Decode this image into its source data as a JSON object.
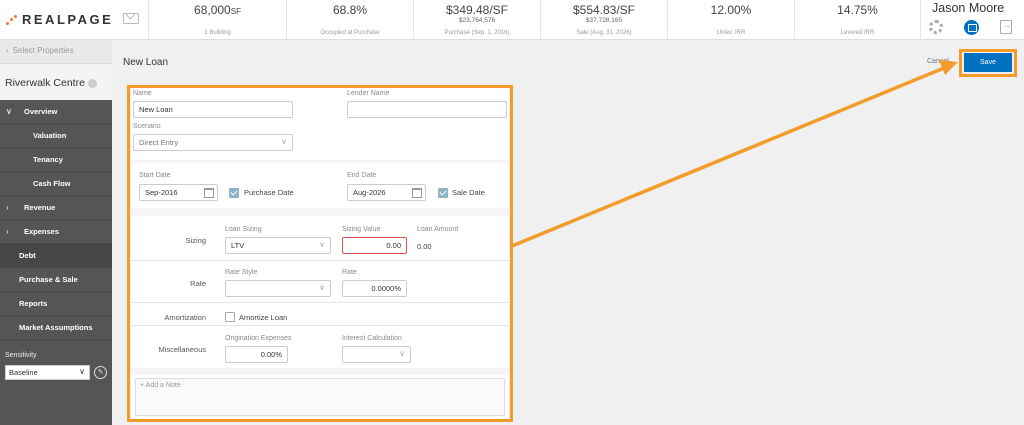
{
  "header": {
    "logo_text": "REALPAGE",
    "metrics": [
      {
        "value": "68,000",
        "unit": "SF",
        "sub": "",
        "caption": "1 Building"
      },
      {
        "value": "68.8%",
        "unit": "",
        "sub": "",
        "caption": "Occupied at Purchase"
      },
      {
        "value": "$349.48/SF",
        "unit": "",
        "sub": "$23,764,576",
        "caption": "Purchase (Sep. 1, 2016)"
      },
      {
        "value": "$554.83/SF",
        "unit": "",
        "sub": "$37,728,165",
        "caption": "Sale (Aug. 31, 2026)"
      },
      {
        "value": "12.00%",
        "unit": "",
        "sub": "",
        "caption": "Unlev. IRR"
      },
      {
        "value": "14.75%",
        "unit": "",
        "sub": "",
        "caption": "Levered IRR"
      }
    ],
    "user_name": "Jason Moore"
  },
  "sidebar": {
    "select_properties": "Select Properties",
    "property_name": "Riverwalk Centre",
    "nav": [
      {
        "label": "Overview",
        "kind": "top",
        "chev": "v"
      },
      {
        "label": "Valuation",
        "kind": "sub"
      },
      {
        "label": "Tenancy",
        "kind": "sub"
      },
      {
        "label": "Cash Flow",
        "kind": "sub"
      },
      {
        "label": "Revenue",
        "kind": "top",
        "chev": ">"
      },
      {
        "label": "Expenses",
        "kind": "top",
        "chev": ">"
      },
      {
        "label": "Debt",
        "kind": "plain"
      },
      {
        "label": "Purchase & Sale",
        "kind": "plain"
      },
      {
        "label": "Reports",
        "kind": "plain"
      },
      {
        "label": "Market Assumptions",
        "kind": "plain"
      }
    ],
    "sensitivity_label": "Sensitivity",
    "sensitivity_value": "Baseline"
  },
  "main": {
    "title": "New Loan",
    "cancel": "Cancel",
    "save": "Save",
    "form": {
      "name_label": "Name",
      "name_value": "New Loan",
      "lender_label": "Lender Name",
      "lender_value": "",
      "scenario_label": "Scenario",
      "scenario_value": "Direct Entry",
      "start_date_label": "Start Date",
      "start_date_value": "Sep-2016",
      "purchase_date_label": "Purchase Date",
      "end_date_label": "End Date",
      "end_date_value": "Aug-2026",
      "sale_date_label": "Sale Date",
      "sizing_row": "Sizing",
      "loan_sizing_label": "Loan Sizing",
      "loan_sizing_value": "LTV",
      "sizing_value_label": "Sizing Value",
      "sizing_value": "0.00",
      "loan_amount_label": "Loan Amount",
      "loan_amount_value": "0.00",
      "rate_row": "Rate",
      "rate_style_label": "Rate Style",
      "rate_style_value": "",
      "rate_label": "Rate",
      "rate_value": "0.0000%",
      "amortization_row": "Amortization",
      "amortize_loan_label": "Amortize Loan",
      "misc_row": "Miscellaneous",
      "origination_label": "Origination Expenses",
      "origination_value": "0.00%",
      "interest_calc_label": "Interest Calculation",
      "interest_calc_value": "",
      "note_placeholder": "+ Add a Note"
    }
  },
  "colors": {
    "accent": "#0070c0",
    "highlight": "#f39c2b",
    "sidebar": "#555555",
    "logo_dots": "#f47b20"
  }
}
